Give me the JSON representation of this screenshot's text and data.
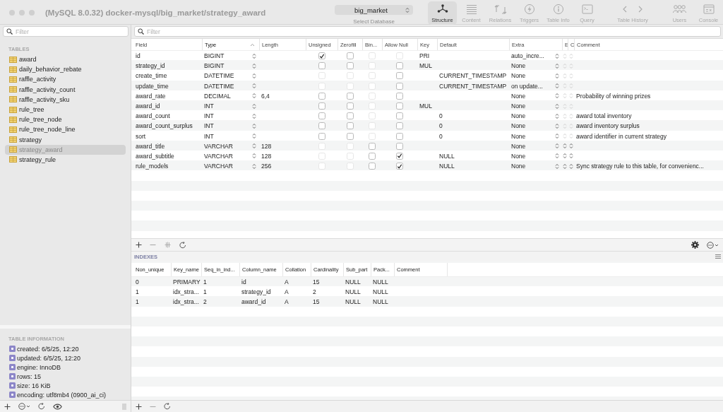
{
  "window": {
    "title": "(MySQL 8.0.32) docker-mysql/big_market/strategy_award"
  },
  "database_selector": {
    "value": "big_market",
    "label": "Select Database"
  },
  "toolbar": [
    {
      "kind": "structure",
      "label": "Structure",
      "selected": true
    },
    {
      "kind": "content",
      "label": "Content",
      "selected": false
    },
    {
      "kind": "relations",
      "label": "Relations",
      "selected": false
    },
    {
      "kind": "triggers",
      "label": "Triggers",
      "selected": false
    },
    {
      "kind": "info",
      "label": "Table Info",
      "selected": false
    },
    {
      "kind": "query",
      "label": "Query",
      "selected": false
    },
    {
      "kind": "history",
      "label": "Table History",
      "selected": false
    },
    {
      "kind": "users",
      "label": "Users",
      "selected": false
    },
    {
      "kind": "console",
      "label": "Console",
      "selected": false
    }
  ],
  "sidebar": {
    "filter": {
      "placeholder": "Filter"
    },
    "section_title": "TABLES",
    "tables": [
      {
        "name": "award",
        "selected": false
      },
      {
        "name": "daily_behavior_rebate",
        "selected": false
      },
      {
        "name": "raffle_activity",
        "selected": false
      },
      {
        "name": "raffle_activity_count",
        "selected": false
      },
      {
        "name": "raffle_activity_sku",
        "selected": false
      },
      {
        "name": "rule_tree",
        "selected": false
      },
      {
        "name": "rule_tree_node",
        "selected": false
      },
      {
        "name": "rule_tree_node_line",
        "selected": false
      },
      {
        "name": "strategy",
        "selected": false
      },
      {
        "name": "strategy_award",
        "selected": true
      },
      {
        "name": "strategy_rule",
        "selected": false
      }
    ],
    "info_title": "TABLE INFORMATION",
    "info": [
      "created: 6/5/25, 12:20",
      "updated: 6/5/25, 12:20",
      "engine: InnoDB",
      "rows: 15",
      "size: 16 KiB",
      "encoding: utf8mb4 (0900_ai_ci)"
    ]
  },
  "structure": {
    "filter": {
      "placeholder": "Filter"
    },
    "columns": [
      {
        "label": "Field",
        "sorted": false
      },
      {
        "label": "Type",
        "sorted": true
      },
      {
        "label": "Length",
        "sorted": false
      },
      {
        "label": "Unsigned",
        "sorted": false
      },
      {
        "label": "Zerofill",
        "sorted": false
      },
      {
        "label": "Bin...",
        "sorted": false
      },
      {
        "label": "Allow Null",
        "sorted": false
      },
      {
        "label": "Key",
        "sorted": false
      },
      {
        "label": "Default",
        "sorted": false
      },
      {
        "label": "Extra",
        "sorted": false
      },
      {
        "label": "E",
        "sorted": false
      },
      {
        "label": "C",
        "sorted": false
      },
      {
        "label": "Comment",
        "sorted": false
      }
    ],
    "fields": [
      {
        "field": "id",
        "type": "BIGINT",
        "unsigned": {
          "checked": true,
          "disabled": false
        },
        "zerofill": {
          "checked": false,
          "disabled": false
        },
        "binary": {
          "checked": false,
          "disabled": true
        },
        "allow_null": {
          "checked": false,
          "disabled": true
        },
        "key": "PRI",
        "extra": "auto_incre...",
        "charset_enabled": false
      },
      {
        "field": "strategy_id",
        "type": "BIGINT",
        "unsigned": {
          "checked": false,
          "disabled": false
        },
        "zerofill": {
          "checked": false,
          "disabled": false
        },
        "binary": {
          "checked": false,
          "disabled": true
        },
        "allow_null": {
          "checked": false,
          "disabled": false
        },
        "key": "MUL",
        "extra": "None",
        "charset_enabled": false
      },
      {
        "field": "create_time",
        "type": "DATETIME",
        "unsigned": {
          "checked": false,
          "disabled": true
        },
        "zerofill": {
          "checked": false,
          "disabled": true
        },
        "binary": {
          "checked": false,
          "disabled": true
        },
        "allow_null": {
          "checked": false,
          "disabled": false
        },
        "default": "CURRENT_TIMESTAMP",
        "extra": "None",
        "charset_enabled": false
      },
      {
        "field": "update_time",
        "type": "DATETIME",
        "unsigned": {
          "checked": false,
          "disabled": true
        },
        "zerofill": {
          "checked": false,
          "disabled": true
        },
        "binary": {
          "checked": false,
          "disabled": true
        },
        "allow_null": {
          "checked": false,
          "disabled": false
        },
        "default": "CURRENT_TIMESTAMP",
        "extra": "on update...",
        "charset_enabled": false
      },
      {
        "field": "award_rate",
        "type": "DECIMAL",
        "length": "6,4",
        "unsigned": {
          "checked": false,
          "disabled": false
        },
        "zerofill": {
          "checked": false,
          "disabled": false
        },
        "binary": {
          "checked": false,
          "disabled": true
        },
        "allow_null": {
          "checked": false,
          "disabled": false
        },
        "extra": "None",
        "charset_enabled": false,
        "comment": "Probability of winning prizes"
      },
      {
        "field": "award_id",
        "type": "INT",
        "unsigned": {
          "checked": false,
          "disabled": false
        },
        "zerofill": {
          "checked": false,
          "disabled": false
        },
        "binary": {
          "checked": false,
          "disabled": true
        },
        "allow_null": {
          "checked": false,
          "disabled": false
        },
        "key": "MUL",
        "extra": "None",
        "charset_enabled": false
      },
      {
        "field": "award_count",
        "type": "INT",
        "unsigned": {
          "checked": false,
          "disabled": false
        },
        "zerofill": {
          "checked": false,
          "disabled": false
        },
        "binary": {
          "checked": false,
          "disabled": true
        },
        "allow_null": {
          "checked": false,
          "disabled": false
        },
        "default": "0",
        "extra": "None",
        "charset_enabled": false,
        "comment": "award total inventory"
      },
      {
        "field": "award_count_surplus",
        "type": "INT",
        "unsigned": {
          "checked": false,
          "disabled": false
        },
        "zerofill": {
          "checked": false,
          "disabled": false
        },
        "binary": {
          "checked": false,
          "disabled": true
        },
        "allow_null": {
          "checked": false,
          "disabled": false
        },
        "default": "0",
        "extra": "None",
        "charset_enabled": false,
        "comment": "award inventory surplus"
      },
      {
        "field": "sort",
        "type": "INT",
        "unsigned": {
          "checked": false,
          "disabled": false
        },
        "zerofill": {
          "checked": false,
          "disabled": false
        },
        "binary": {
          "checked": false,
          "disabled": true
        },
        "allow_null": {
          "checked": false,
          "disabled": false
        },
        "default": "0",
        "extra": "None",
        "charset_enabled": false,
        "comment": "award identifier in current strategy"
      },
      {
        "field": "award_title",
        "type": "VARCHAR",
        "length": "128",
        "unsigned": {
          "checked": false,
          "disabled": true
        },
        "zerofill": {
          "checked": false,
          "disabled": true
        },
        "binary": {
          "checked": false,
          "disabled": false
        },
        "allow_null": {
          "checked": false,
          "disabled": false
        },
        "extra": "None",
        "charset_enabled": true
      },
      {
        "field": "award_subtitle",
        "type": "VARCHAR",
        "length": "128",
        "unsigned": {
          "checked": false,
          "disabled": true
        },
        "zerofill": {
          "checked": false,
          "disabled": true
        },
        "binary": {
          "checked": false,
          "disabled": false
        },
        "allow_null": {
          "checked": true,
          "disabled": false
        },
        "default": "NULL",
        "extra": "None",
        "charset_enabled": true
      },
      {
        "field": "rule_models",
        "type": "VARCHAR",
        "length": "256",
        "unsigned": {
          "checked": false,
          "disabled": true
        },
        "zerofill": {
          "checked": false,
          "disabled": true
        },
        "binary": {
          "checked": false,
          "disabled": false
        },
        "allow_null": {
          "checked": true,
          "disabled": false
        },
        "default": "NULL",
        "extra": "None",
        "charset_enabled": true,
        "comment": "Sync strategy rule to this table, for convenienc..."
      }
    ]
  },
  "indexes": {
    "title": "INDEXES",
    "columns": [
      "Non_unique",
      "Key_name",
      "Seq_in_ind...",
      "Column_name",
      "Collation",
      "Cardinality",
      "Sub_part",
      "Pack...",
      "Comment"
    ],
    "rows": [
      [
        "0",
        "PRIMARY",
        "1",
        "id",
        "A",
        "15",
        "NULL",
        "NULL"
      ],
      [
        "1",
        "idx_stra...",
        "1",
        "strategy_id",
        "A",
        "2",
        "NULL",
        "NULL"
      ],
      [
        "1",
        "idx_stra...",
        "2",
        "award_id",
        "A",
        "15",
        "NULL",
        "NULL"
      ]
    ]
  }
}
